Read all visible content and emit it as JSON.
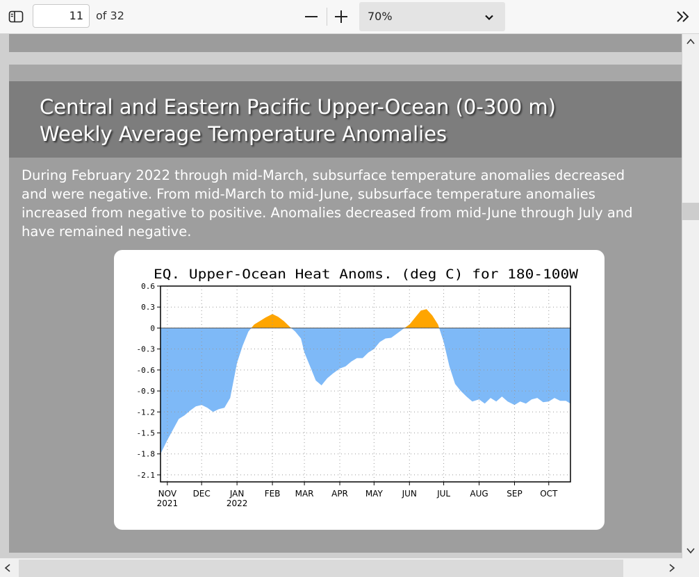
{
  "toolbar": {
    "page_current": "11",
    "page_total_label": "of 32",
    "zoom_value": "70%"
  },
  "slide": {
    "title_line1": "Central and Eastern Pacific Upper-Ocean (0-300 m)",
    "title_line2": "Weekly Average Temperature Anomalies",
    "body_lines": [
      "During February 2022 through mid-March, subsurface temperature anomalies decreased",
      "and were negative.  From mid-March to mid-June, subsurface temperature anomalies",
      "increased from negative to positive.  Anomalies decreased from mid-June through July and",
      "have remained negative."
    ]
  },
  "chart_data": {
    "type": "area",
    "title": "EQ. Upper-Ocean Heat Anoms. (deg C) for 180-100W",
    "xlabel": "",
    "ylabel": "",
    "ylim": [
      -2.2,
      0.6
    ],
    "yticks": [
      0.6,
      0.3,
      0,
      -0.3,
      -0.6,
      -0.9,
      -1.2,
      -1.5,
      -1.8,
      -2.1
    ],
    "ytick_labels": [
      "0.6",
      "0.3",
      "0",
      "-0.3",
      "-0.6",
      "-0.9",
      "-1.2",
      "-1.5",
      "-1.8",
      "-2.1"
    ],
    "xlim": [
      "2021-10-26",
      "2022-10-20"
    ],
    "xticks": [
      {
        "label": "NOV",
        "sub": "2021",
        "date": "2021-11-01"
      },
      {
        "label": "DEC",
        "sub": "",
        "date": "2021-12-01"
      },
      {
        "label": "JAN",
        "sub": "2022",
        "date": "2022-01-01"
      },
      {
        "label": "FEB",
        "sub": "",
        "date": "2022-02-01"
      },
      {
        "label": "MAR",
        "sub": "",
        "date": "2022-03-01"
      },
      {
        "label": "APR",
        "sub": "",
        "date": "2022-04-01"
      },
      {
        "label": "MAY",
        "sub": "",
        "date": "2022-05-01"
      },
      {
        "label": "JUN",
        "sub": "",
        "date": "2022-06-01"
      },
      {
        "label": "JUL",
        "sub": "",
        "date": "2022-07-01"
      },
      {
        "label": "AUG",
        "sub": "",
        "date": "2022-08-01"
      },
      {
        "label": "SEP",
        "sub": "",
        "date": "2022-09-01"
      },
      {
        "label": "OCT",
        "sub": "",
        "date": "2022-10-01"
      }
    ],
    "grid": true,
    "positive_color": "#ffa500",
    "negative_color": "#7eb9f7",
    "series": [
      {
        "x": [
          "2021-10-26",
          "2021-11-01",
          "2021-11-06",
          "2021-11-11",
          "2021-11-16",
          "2021-11-21",
          "2021-11-26",
          "2021-12-01",
          "2021-12-06",
          "2021-12-11",
          "2021-12-16",
          "2021-12-21",
          "2021-12-26",
          "2022-01-01",
          "2022-01-06",
          "2022-01-11",
          "2022-01-16",
          "2022-01-21",
          "2022-01-26",
          "2022-02-01",
          "2022-02-06",
          "2022-02-11",
          "2022-02-16",
          "2022-02-21",
          "2022-02-26",
          "2022-03-01",
          "2022-03-06",
          "2022-03-11",
          "2022-03-16",
          "2022-03-21",
          "2022-03-26",
          "2022-04-01",
          "2022-04-06",
          "2022-04-11",
          "2022-04-16",
          "2022-04-21",
          "2022-04-26",
          "2022-05-01",
          "2022-05-06",
          "2022-05-11",
          "2022-05-16",
          "2022-05-21",
          "2022-05-26",
          "2022-06-01",
          "2022-06-06",
          "2022-06-11",
          "2022-06-16",
          "2022-06-21",
          "2022-06-26",
          "2022-07-01",
          "2022-07-06",
          "2022-07-11",
          "2022-07-16",
          "2022-07-21",
          "2022-07-26",
          "2022-08-01",
          "2022-08-06",
          "2022-08-11",
          "2022-08-16",
          "2022-08-21",
          "2022-08-26",
          "2022-09-01",
          "2022-09-06",
          "2022-09-11",
          "2022-09-16",
          "2022-09-21",
          "2022-09-26",
          "2022-10-01",
          "2022-10-06",
          "2022-10-11",
          "2022-10-16",
          "2022-10-20"
        ],
        "values": [
          -1.8,
          -1.6,
          -1.45,
          -1.3,
          -1.25,
          -1.18,
          -1.12,
          -1.1,
          -1.14,
          -1.2,
          -1.16,
          -1.14,
          -1.0,
          -0.5,
          -0.25,
          -0.05,
          0.05,
          0.1,
          0.15,
          0.2,
          0.16,
          0.1,
          0.02,
          -0.05,
          -0.15,
          -0.35,
          -0.55,
          -0.75,
          -0.82,
          -0.72,
          -0.65,
          -0.58,
          -0.55,
          -0.48,
          -0.43,
          -0.43,
          -0.35,
          -0.3,
          -0.2,
          -0.15,
          -0.14,
          -0.08,
          -0.02,
          0.05,
          0.15,
          0.25,
          0.27,
          0.18,
          0.05,
          -0.2,
          -0.55,
          -0.8,
          -0.9,
          -0.98,
          -1.05,
          -1.02,
          -1.08,
          -1.0,
          -1.05,
          -0.98,
          -1.05,
          -1.1,
          -1.05,
          -1.08,
          -1.02,
          -1.0,
          -1.06,
          -1.05,
          -1.0,
          -1.04,
          -1.04,
          -1.08
        ]
      }
    ]
  }
}
